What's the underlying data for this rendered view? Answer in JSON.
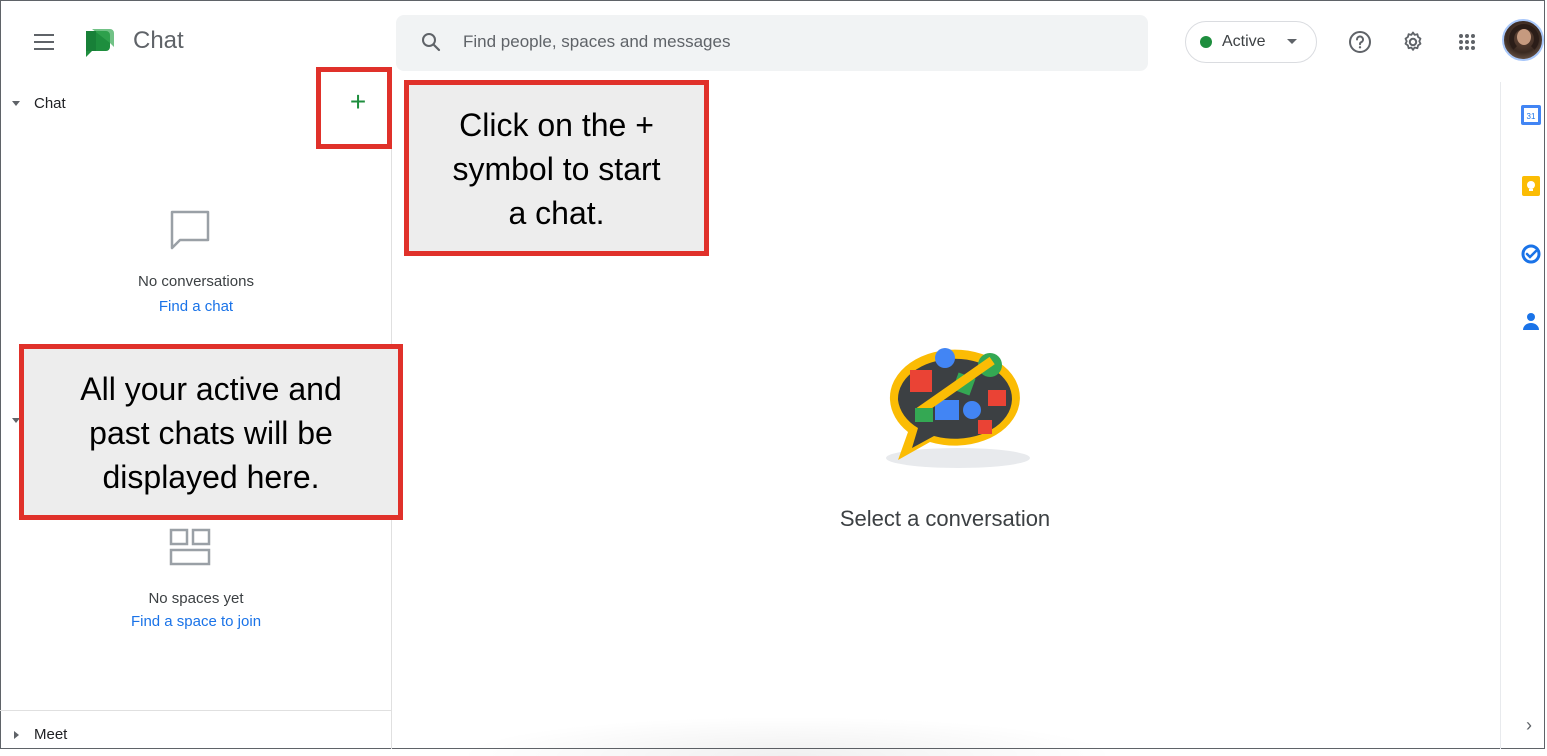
{
  "header": {
    "app_title": "Chat",
    "search_placeholder": "Find people, spaces and messages",
    "status_label": "Active",
    "brand_color": "#1e8e3e",
    "icons": [
      "menu-icon",
      "chat-logo-icon",
      "search-icon",
      "help-icon",
      "settings-icon",
      "apps-grid-icon",
      "avatar"
    ]
  },
  "sidebar": {
    "chat_section": {
      "label": "Chat",
      "empty_text": "No conversations",
      "empty_link": "Find a chat"
    },
    "spaces_section": {
      "empty_text": "No spaces yet",
      "empty_link": "Find a space to join"
    },
    "meet_section": {
      "label": "Meet"
    },
    "new_chat_symbol": "+"
  },
  "annotations": {
    "plus_callout": [
      "Click on the +",
      "symbol to start",
      "a chat."
    ],
    "list_callout": [
      "All your active and",
      "past chats will be",
      "displayed here."
    ],
    "callout_color": "#e0312a"
  },
  "main": {
    "empty_state_text": "Select a conversation"
  },
  "right_rail": {
    "icons": [
      "calendar-icon",
      "keep-icon",
      "tasks-icon",
      "contacts-icon",
      "chevron-right-icon"
    ],
    "calendar_number": "31",
    "chevron": "›"
  }
}
